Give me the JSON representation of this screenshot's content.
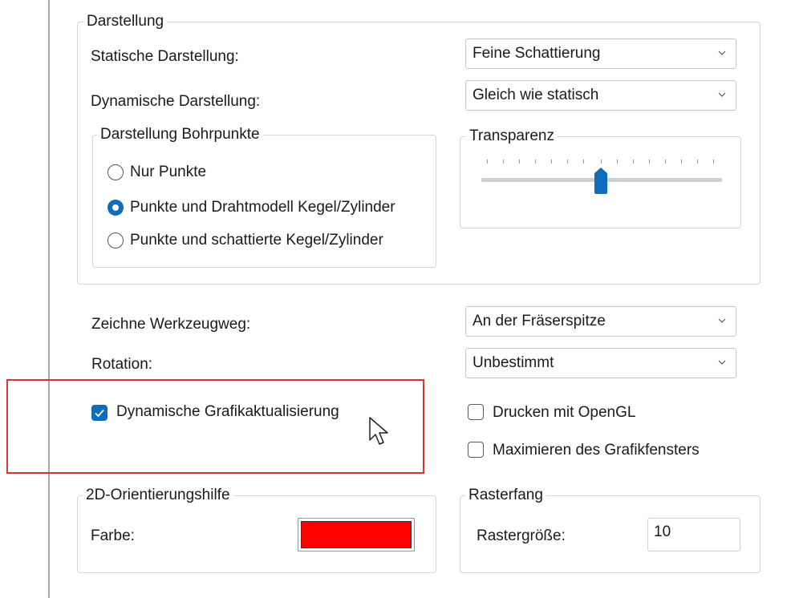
{
  "display_group": {
    "title": "Darstellung",
    "static_label": "Statische Darstellung:",
    "static_value": "Feine Schattierung",
    "dynamic_label": "Dynamische Darstellung:",
    "dynamic_value": "Gleich wie statisch"
  },
  "drill_group": {
    "title": "Darstellung Bohrpunkte",
    "options": [
      {
        "label": "Nur Punkte",
        "selected": false
      },
      {
        "label": "Punkte und Drahtmodell Kegel/Zylinder",
        "selected": true
      },
      {
        "label": "Punkte und schattierte Kegel/Zylinder",
        "selected": false
      }
    ]
  },
  "transparency": {
    "title": "Transparenz",
    "value_fraction": 0.5
  },
  "toolpath": {
    "label": "Zeichne Werkzeugweg:",
    "value": "An der Fräserspitze"
  },
  "rotation": {
    "label": "Rotation:",
    "value": "Unbestimmt"
  },
  "checkboxes": {
    "dynamic_update": {
      "label": "Dynamische Grafikaktualisierung",
      "checked": true
    },
    "print_opengl": {
      "label": "Drucken mit OpenGL",
      "checked": false
    },
    "maximize_window": {
      "label": "Maximieren des Grafikfensters",
      "checked": false
    }
  },
  "orientation_group": {
    "title": "2D-Orientierungshilfe",
    "color_label": "Farbe:",
    "color_value": "#ff0000"
  },
  "snap_group": {
    "title": "Rasterfang",
    "size_label": "Rastergröße:",
    "size_value": "10"
  },
  "colors": {
    "accent": "#0f6cbd",
    "highlight": "#d93434"
  },
  "icons": [
    "chevron-down-icon",
    "checkmark-icon",
    "mouse-pointer-icon",
    "slider-thumb-icon"
  ]
}
